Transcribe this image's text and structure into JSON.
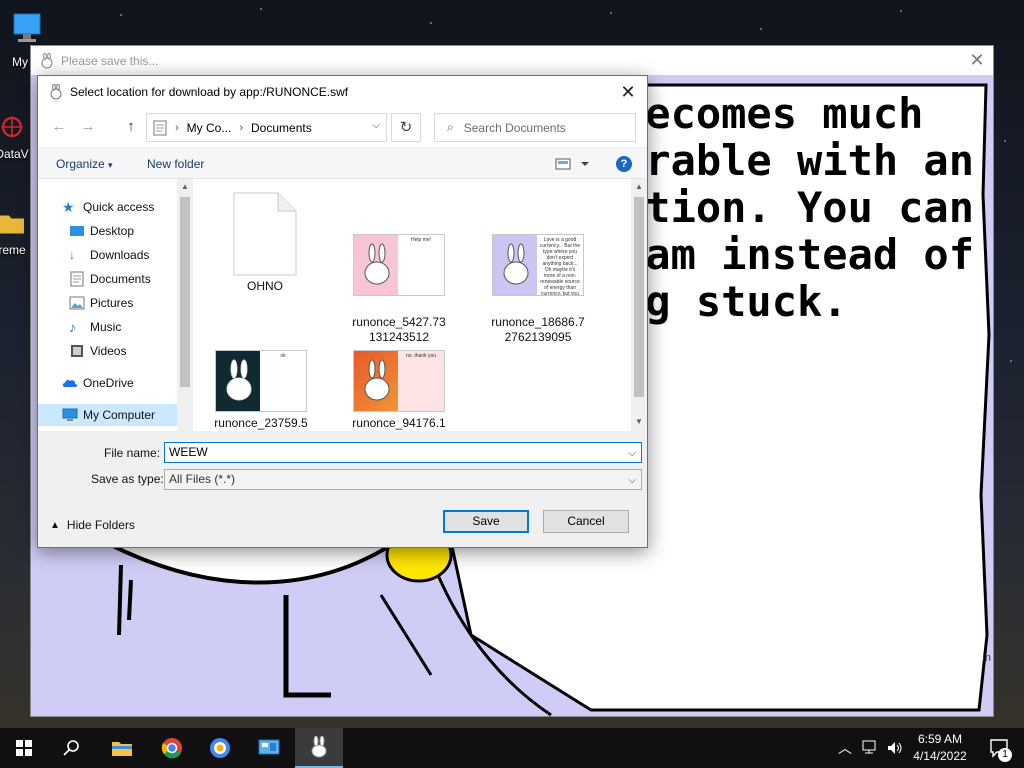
{
  "desktop": {
    "icons": [
      {
        "label": "My C",
        "icon": "computer-icon"
      },
      {
        "label": "DataV",
        "icon": "datav-icon"
      },
      {
        "label": "reme",
        "icon": "folder-icon"
      }
    ]
  },
  "app": {
    "title": "Please save this...",
    "speech_lines": "becomes much\narable with an\nation. You can\neam instead of\nng stuck.",
    "corner_text": "in"
  },
  "dialog": {
    "title": "Select location for download by app:/RUNONCE.swf",
    "address": {
      "segments": [
        "My Co...",
        "Documents"
      ]
    },
    "search_placeholder": "Search Documents",
    "organize_label": "Organize",
    "new_folder_label": "New folder",
    "nav": [
      {
        "label": "Quick access",
        "icon": "star-icon",
        "pinned": false
      },
      {
        "label": "Desktop",
        "icon": "desktop-icon",
        "pinned": true
      },
      {
        "label": "Downloads",
        "icon": "downloads-icon",
        "pinned": true
      },
      {
        "label": "Documents",
        "icon": "documents-icon",
        "pinned": true
      },
      {
        "label": "Pictures",
        "icon": "pictures-icon",
        "pinned": true
      },
      {
        "label": "Music",
        "icon": "music-icon",
        "pinned": false
      },
      {
        "label": "Videos",
        "icon": "videos-icon",
        "pinned": false
      },
      {
        "label": "OneDrive",
        "icon": "cloud-icon",
        "pinned": false
      },
      {
        "label": "My Computer",
        "icon": "computer-icon",
        "pinned": false,
        "selected": true
      }
    ],
    "files": [
      {
        "name": "OHNO",
        "kind": "blank"
      },
      {
        "name": "runonce_5427.73\n131243512",
        "kind": "thumb",
        "bg": "#f7c5d4",
        "card_text": "Help me!"
      },
      {
        "name": "runonce_18686.7\n2762139095",
        "kind": "thumb",
        "bg": "#c9c6f2",
        "card_text": "Love is a good currency... But the type where you don't expect anything back... Oh maybe it's more of a non-renewable source of energy than currency, but you get the point"
      },
      {
        "name": "runonce_23759.5",
        "kind": "thumb",
        "bg": "#0f2a33",
        "card_text": "ok"
      },
      {
        "name": "runonce_94176.1",
        "kind": "thumb",
        "bg": "#e8582a",
        "card_text": "no. thank you"
      }
    ],
    "file_name_label": "File name:",
    "file_name_value": "WEEW",
    "save_type_label": "Save as type:",
    "save_type_value": "All Files (*.*)",
    "hide_folders_label": "Hide Folders",
    "save_label": "Save",
    "cancel_label": "Cancel"
  },
  "taskbar": {
    "time": "6:59 AM",
    "date": "4/14/2022",
    "notification_count": "1"
  },
  "colors": {
    "accent": "#0078d7",
    "app_bg": "#cfcdf5",
    "nav_selected": "#cce8ff"
  }
}
